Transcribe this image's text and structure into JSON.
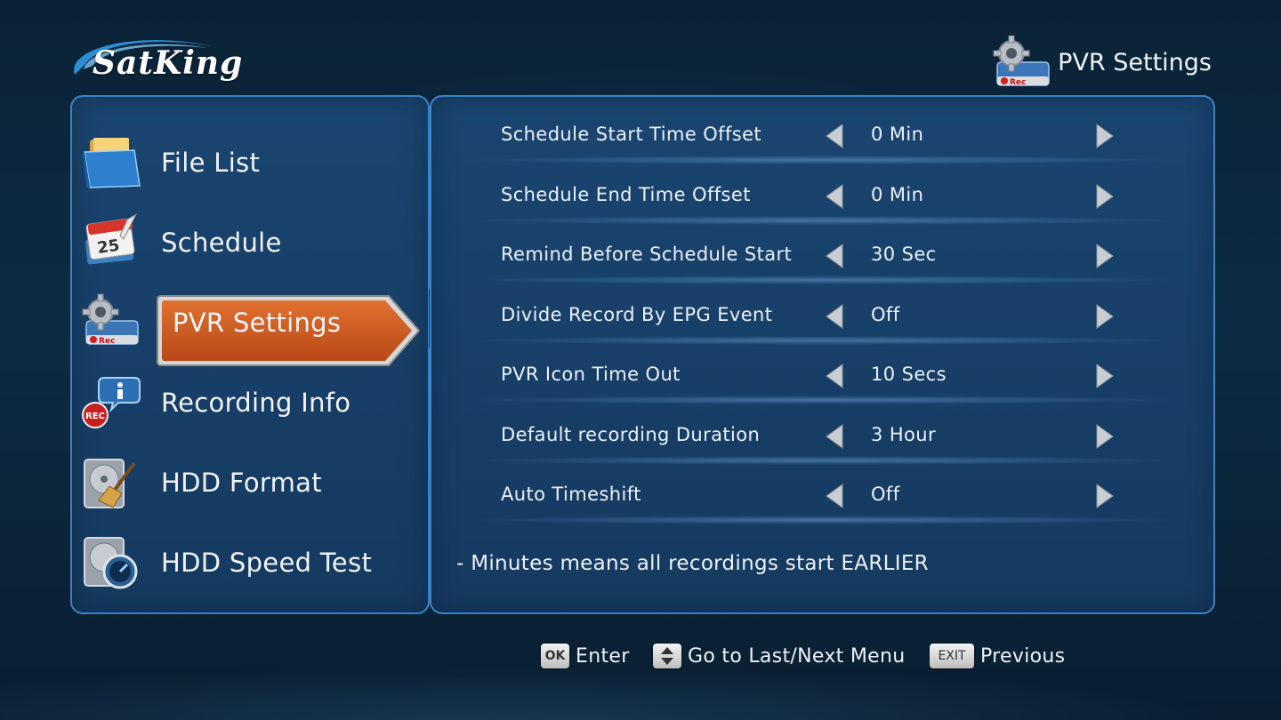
{
  "brand": {
    "name": "SatKing"
  },
  "header": {
    "title": "PVR Settings",
    "title_icon": "pvr-gear-rec-icon"
  },
  "sidebar": {
    "items": [
      {
        "label": "File List",
        "icon": "folder-icon",
        "selected": false
      },
      {
        "label": "Schedule",
        "icon": "calendar-icon",
        "calendar_day": "25",
        "selected": false
      },
      {
        "label": "PVR Settings",
        "icon": "pvr-gear-rec-icon",
        "selected": true
      },
      {
        "label": "Recording Info",
        "icon": "rec-info-icon",
        "selected": false
      },
      {
        "label": "HDD Format",
        "icon": "hdd-broom-icon",
        "selected": false
      },
      {
        "label": "HDD Speed Test",
        "icon": "hdd-speed-icon",
        "selected": false
      }
    ]
  },
  "settings": [
    {
      "label": "Schedule Start Time Offset",
      "value": "0 Min"
    },
    {
      "label": "Schedule End Time Offset",
      "value": "0 Min"
    },
    {
      "label": "Remind Before Schedule Start",
      "value": "30 Sec"
    },
    {
      "label": "Divide Record By EPG Event",
      "value": "Off"
    },
    {
      "label": "PVR Icon Time Out",
      "value": "10 Secs"
    },
    {
      "label": "Default recording Duration",
      "value": "3 Hour"
    },
    {
      "label": "Auto Timeshift",
      "value": "Off"
    }
  ],
  "hint": "- Minutes means all recordings start EARLIER",
  "footer": {
    "ok_key": "OK",
    "ok_label": "Enter",
    "updown_label": "Go to Last/Next Menu",
    "exit_key": "EXIT",
    "exit_label": "Previous"
  },
  "colors": {
    "accent": "#c9541f",
    "panel_border": "#3a83c8",
    "background": "#0d2b44"
  }
}
